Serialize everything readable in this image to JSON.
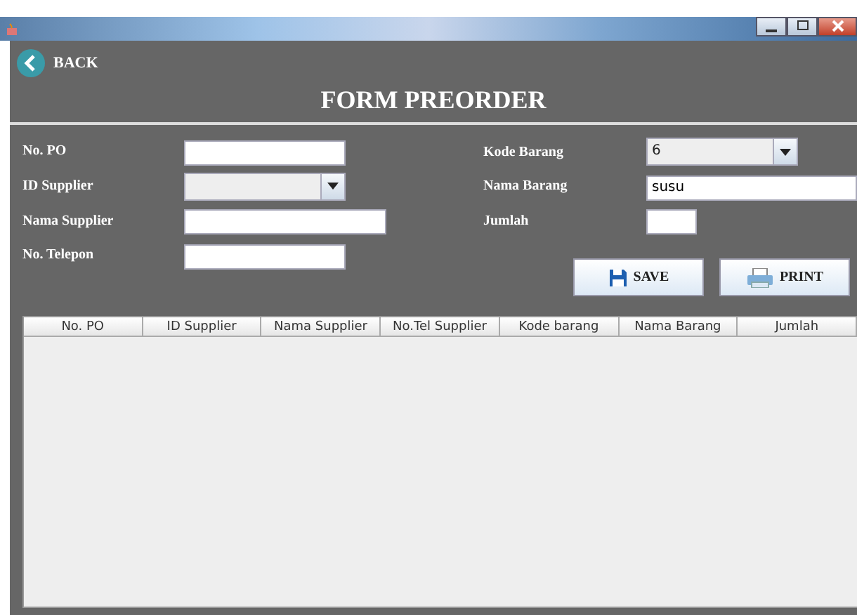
{
  "back_button": {
    "label": "BACK"
  },
  "title": "FORM PREORDER",
  "left_fields": [
    {
      "label": "No. PO",
      "kind": "text"
    },
    {
      "label": "ID Supplier",
      "kind": "combo"
    },
    {
      "label": "Nama Supplier",
      "kind": "wide"
    },
    {
      "label": "No. Telepon",
      "kind": "text"
    }
  ],
  "right_fields": [
    {
      "label": "Kode Barang",
      "kind": "combo",
      "value": "6"
    },
    {
      "label": "Nama Barang",
      "kind": "text",
      "value": "susu"
    },
    {
      "label": "Jumlah",
      "kind": "short"
    }
  ],
  "buttons": [
    {
      "label": "SAVE",
      "kind": "save"
    },
    {
      "label": "PRINT",
      "kind": "print"
    }
  ],
  "table": {
    "columns": [
      "No. PO",
      "ID Supplier",
      "Nama Supplier",
      "No.Tel Supplier",
      "Kode barang",
      "Nama Barang",
      "Jumlah"
    ]
  }
}
